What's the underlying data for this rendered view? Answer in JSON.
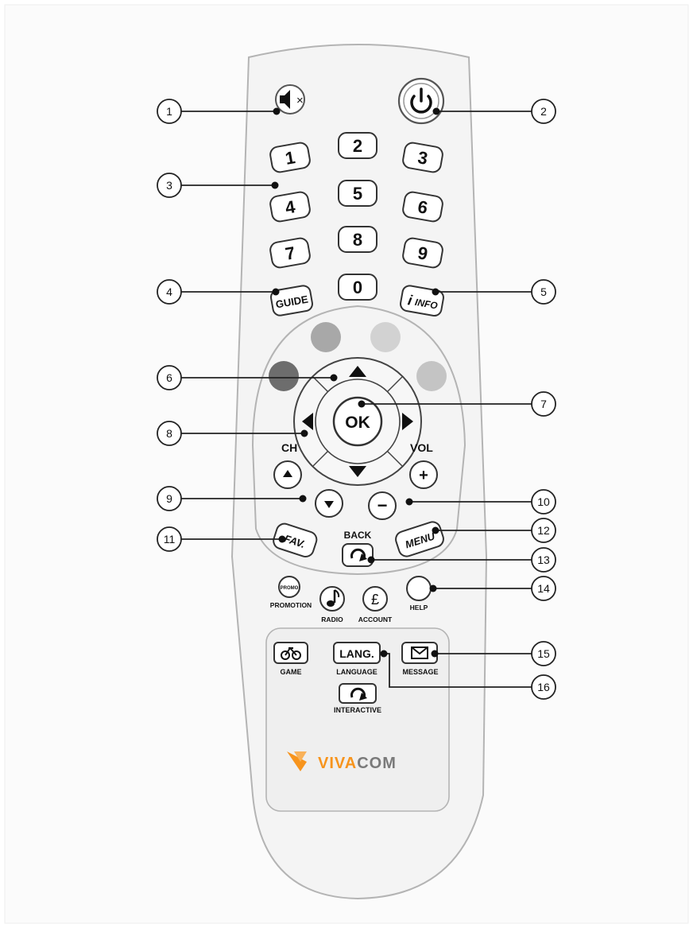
{
  "callouts": [
    "1",
    "2",
    "3",
    "4",
    "5",
    "6",
    "7",
    "8",
    "9",
    "10",
    "11",
    "12",
    "13",
    "14",
    "15",
    "16"
  ],
  "buttons": {
    "mute_glyph": "◀×",
    "digits": [
      "1",
      "2",
      "3",
      "4",
      "5",
      "6",
      "7",
      "8",
      "9",
      "0"
    ],
    "guide": "GUIDE",
    "info": "INFO",
    "info_prefix": "i",
    "ok": "OK",
    "ch": "CH",
    "vol": "VOL",
    "vol_plus": "+",
    "vol_minus": "−",
    "fav": "FAV.",
    "back": "BACK",
    "menu": "MENU",
    "promo": "PROMO",
    "promotion": "PROMOTION",
    "radio": "RADIO",
    "account": "ACCOUNT",
    "account_symbol": "£",
    "help": "HELP",
    "game": "GAME",
    "lang": "LANG.",
    "language": "LANGUAGE",
    "message": "MESSAGE",
    "interactive": "INTERACTIVE"
  },
  "brand": {
    "prefix": "VIVA",
    "suffix": "COM",
    "accent": "#f7941d",
    "text_color": "#7a7a7a"
  },
  "colors": {
    "body_fill": "#f4f4f4",
    "color_keys": [
      "#6d6d6d",
      "#a8a8a8",
      "#d2d2d2",
      "#c4c4c4"
    ]
  },
  "icons": [
    "mute-icon",
    "power-icon",
    "up-arrow-icon",
    "down-arrow-icon",
    "left-arrow-icon",
    "right-arrow-icon",
    "back-refresh-icon",
    "music-note-icon",
    "game-bike-icon",
    "envelope-icon",
    "interactive-refresh-icon",
    "vivacom-logo-icon"
  ]
}
